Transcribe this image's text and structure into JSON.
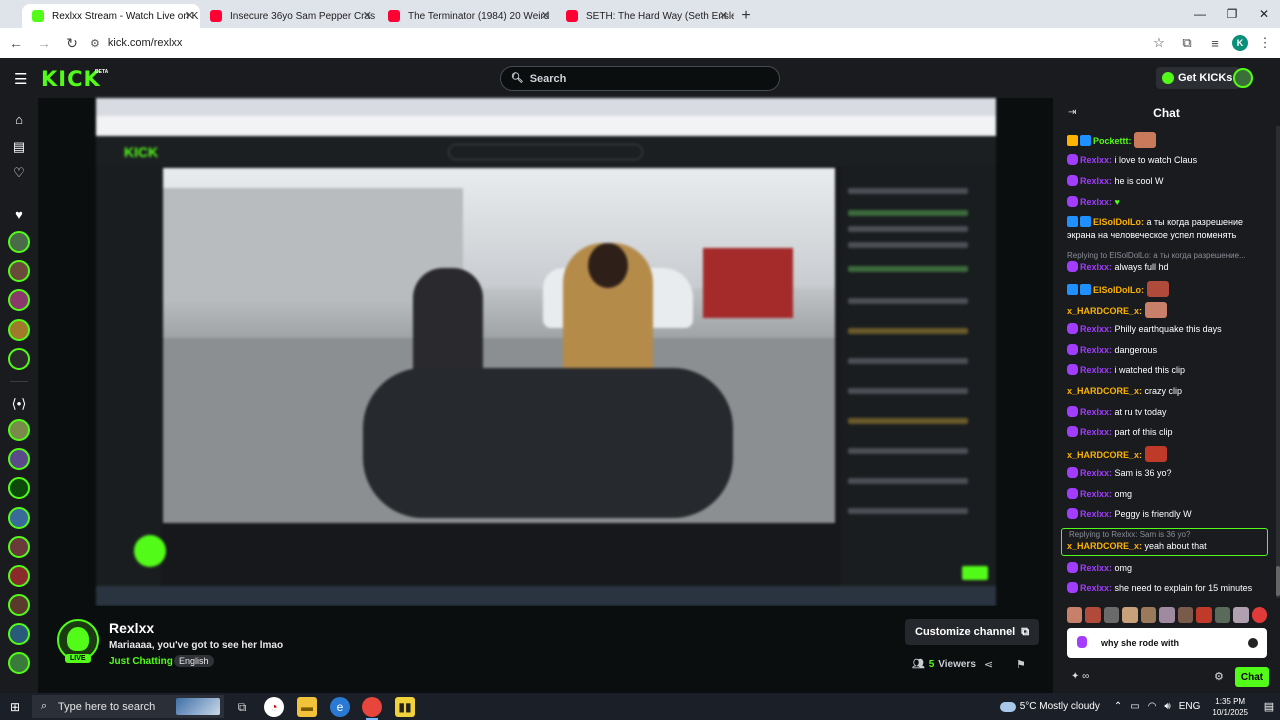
{
  "browser": {
    "tabs": [
      {
        "title": "Rexlxx Stream - Watch Live on K",
        "active": true,
        "favicon_color": "#53fc18"
      },
      {
        "title": "Insecure 36yo Sam Pepper Cras",
        "active": false,
        "favicon_color": "#ff0033"
      },
      {
        "title": "The Terminator (1984) 20 Weird",
        "active": false,
        "favicon_color": "#ff0033"
      },
      {
        "title": "SETH: The Hard Way (Seth Ensle",
        "active": false,
        "favicon_color": "#ff0033"
      }
    ],
    "url": "kick.com/rexlxx",
    "profile_initial": "K"
  },
  "header": {
    "logo": "KICK",
    "beta": "BETA",
    "search_placeholder": "Search",
    "get_kicks": "Get KICKs"
  },
  "channel": {
    "name": "Rexlxx",
    "live_label": "LIVE",
    "stream_title": "Mariaaaa, you've got to see her lmao",
    "category": "Just Chatting",
    "tag": "English",
    "customize": "Customize channel",
    "viewers_count": "5",
    "viewers_label": "Viewers"
  },
  "chat": {
    "title": "Chat",
    "replies": [
      {
        "text": "Replying to ElSolDolLo: а ты когда разрешение..."
      },
      {
        "text": "Replying to Rexlxx: Sam is 36 yo?"
      }
    ],
    "messages": [
      {
        "user": "Pockettt:",
        "text": "",
        "color": "#53fc18",
        "badge": "#ffb300",
        "emote": true
      },
      {
        "user": "Rexlxx:",
        "text": " i love to watch Claus",
        "color": "#a23cff",
        "badge": "#a23cff"
      },
      {
        "user": "Rexlxx:",
        "text": " he is cool W",
        "color": "#a23cff",
        "badge": "#a23cff"
      },
      {
        "user": "Rexlxx:",
        "text": " ♥",
        "color": "#a23cff",
        "badge": "#a23cff"
      },
      {
        "user": "ElSolDolLo:",
        "text": " а ты когда разрешение экрана на человеческое успел поменять",
        "color": "#ffb300",
        "badge": "#1e90ff"
      },
      {
        "user": "Rexlxx:",
        "text": " always full hd",
        "color": "#a23cff",
        "badge": "#a23cff"
      },
      {
        "user": "ElSolDolLo:",
        "text": "",
        "color": "#ffb300",
        "badge": "#1e90ff",
        "emote": true
      },
      {
        "user": "x_HARDCORE_x:",
        "text": "",
        "color": "#ffb300",
        "badge": "",
        "emote": true
      },
      {
        "user": "Rexlxx:",
        "text": " Philly earthquake this days",
        "color": "#a23cff",
        "badge": "#a23cff"
      },
      {
        "user": "Rexlxx:",
        "text": " dangerous",
        "color": "#a23cff",
        "badge": "#a23cff"
      },
      {
        "user": "Rexlxx:",
        "text": " i watched this clip",
        "color": "#a23cff",
        "badge": "#a23cff"
      },
      {
        "user": "x_HARDCORE_x:",
        "text": " crazy clip",
        "color": "#ffb300",
        "badge": ""
      },
      {
        "user": "Rexlxx:",
        "text": " at ru tv today",
        "color": "#a23cff",
        "badge": "#a23cff"
      },
      {
        "user": "Rexlxx:",
        "text": " part of this clip",
        "color": "#a23cff",
        "badge": "#a23cff"
      },
      {
        "user": "x_HARDCORE_x:",
        "text": "",
        "color": "#ffb300",
        "badge": "",
        "emote": true
      },
      {
        "user": "Rexlxx:",
        "text": " Sam is 36 yo?",
        "color": "#a23cff",
        "badge": "#a23cff"
      },
      {
        "user": "Rexlxx:",
        "text": " omg",
        "color": "#a23cff",
        "badge": "#a23cff"
      },
      {
        "user": "Rexlxx:",
        "text": " Peggy is friendly W",
        "color": "#a23cff",
        "badge": "#a23cff"
      },
      {
        "user": "x_HARDCORE_x:",
        "text": " yeah about that",
        "color": "#ffb300",
        "badge": ""
      },
      {
        "user": "Rexlxx:",
        "text": " omg",
        "color": "#a23cff",
        "badge": "#a23cff"
      },
      {
        "user": "Rexlxx:",
        "text": " she need to explain for 15 minutes",
        "color": "#a23cff",
        "badge": "#a23cff"
      }
    ],
    "input_value": "why she rode with",
    "send_label": "Chat"
  },
  "taskbar": {
    "search_placeholder": "Type here to search",
    "weather": "5°C  Mostly cloudy",
    "language": "ENG",
    "time": "1:35 PM",
    "date": "10/1/2025"
  },
  "colors": {
    "accent": "#53fc18",
    "bg": "#0b0e0f",
    "panel": "#191b1f"
  }
}
